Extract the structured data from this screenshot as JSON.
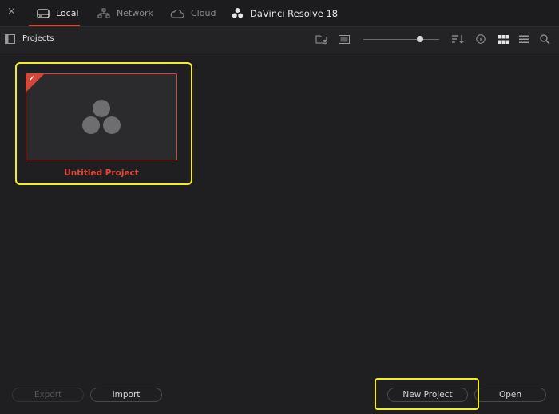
{
  "topbar": {
    "close_label": "×",
    "tabs": [
      {
        "label": "Local",
        "icon": "drive-icon",
        "active": true
      },
      {
        "label": "Network",
        "icon": "network-icon",
        "active": false
      },
      {
        "label": "Cloud",
        "icon": "cloud-icon",
        "active": false
      },
      {
        "label": "DaVinci Resolve 18",
        "icon": "davinci-logo-icon",
        "active": false
      }
    ]
  },
  "subbar": {
    "title": "Projects",
    "icons": [
      "sidebar-toggle-icon",
      "new-folder-icon",
      "display-icon",
      "sort-icon",
      "info-icon",
      "grid-view-icon",
      "list-view-icon",
      "search-icon"
    ],
    "thumbnail_size_level": 0.75
  },
  "project": {
    "name": "Untitled Project",
    "selected": true
  },
  "footer": {
    "export_label": "Export",
    "import_label": "Import",
    "new_project_label": "New Project",
    "open_label": "Open"
  },
  "colors": {
    "accent_red": "#d6473a",
    "highlight_yellow": "#f5ee1e",
    "background": "#1f1f22"
  }
}
